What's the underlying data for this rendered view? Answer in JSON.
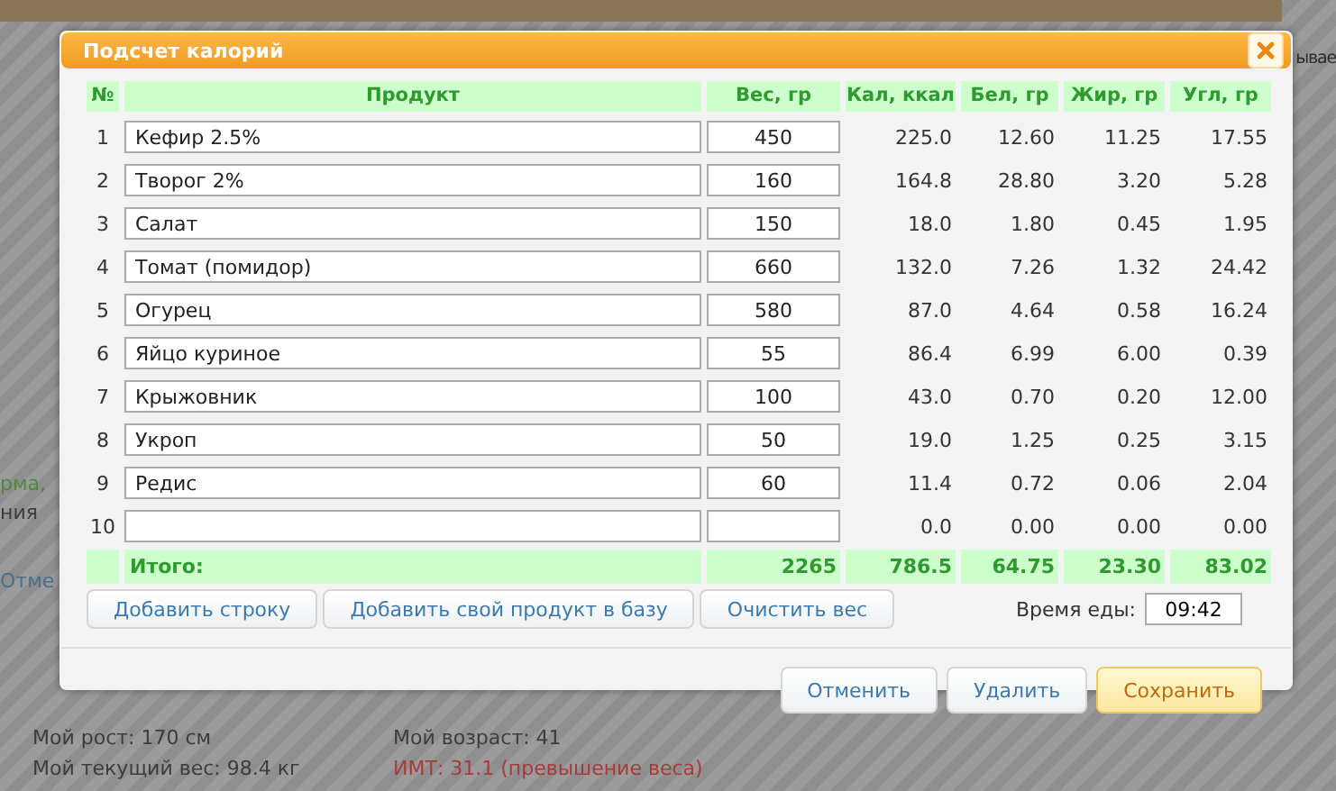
{
  "background_page": {
    "side_notes": [
      {
        "text": "рма,",
        "kind": "highlight"
      },
      {
        "text": "ния",
        "kind": "plain"
      },
      {
        "text": "Отме",
        "kind": "link"
      }
    ],
    "right_note": "ывае",
    "stats": [
      {
        "text": "Мой рост: 170 см",
        "kind": "plain"
      },
      {
        "text": "Мой возраст: 41",
        "kind": "plain"
      },
      {
        "text": "Мой текущий вес: 98.4 кг",
        "kind": "plain"
      },
      {
        "text": "ИМТ: 31.1 (превышение веса)",
        "kind": "warning"
      }
    ]
  },
  "dialog": {
    "title": "Подсчет калорий",
    "columns": [
      "№",
      "Продукт",
      "Вес, гр",
      "Кал, ккал",
      "Бел, гр",
      "Жир, гр",
      "Угл, гр"
    ],
    "rows": [
      {
        "number": "1",
        "product": "Кефир 2.5%",
        "weight": "450",
        "kcal": "225.0",
        "protein": "12.60",
        "fat": "11.25",
        "carbs": "17.55"
      },
      {
        "number": "2",
        "product": "Творог 2%",
        "weight": "160",
        "kcal": "164.8",
        "protein": "28.80",
        "fat": "3.20",
        "carbs": "5.28"
      },
      {
        "number": "3",
        "product": "Салат",
        "weight": "150",
        "kcal": "18.0",
        "protein": "1.80",
        "fat": "0.45",
        "carbs": "1.95"
      },
      {
        "number": "4",
        "product": "Томат (помидор)",
        "weight": "660",
        "kcal": "132.0",
        "protein": "7.26",
        "fat": "1.32",
        "carbs": "24.42"
      },
      {
        "number": "5",
        "product": "Огурец",
        "weight": "580",
        "kcal": "87.0",
        "protein": "4.64",
        "fat": "0.58",
        "carbs": "16.24"
      },
      {
        "number": "6",
        "product": "Яйцо куриное",
        "weight": "55",
        "kcal": "86.4",
        "protein": "6.99",
        "fat": "6.00",
        "carbs": "0.39"
      },
      {
        "number": "7",
        "product": "Крыжовник",
        "weight": "100",
        "kcal": "43.0",
        "protein": "0.70",
        "fat": "0.20",
        "carbs": "12.00"
      },
      {
        "number": "8",
        "product": "Укроп",
        "weight": "50",
        "kcal": "19.0",
        "protein": "1.25",
        "fat": "0.25",
        "carbs": "3.15"
      },
      {
        "number": "9",
        "product": "Редис",
        "weight": "60",
        "kcal": "11.4",
        "protein": "0.72",
        "fat": "0.06",
        "carbs": "2.04"
      },
      {
        "number": "10",
        "kcal": "0.0",
        "protein": "0.00",
        "fat": "0.00",
        "carbs": "0.00"
      }
    ],
    "totals": {
      "label": "Итого:",
      "weight": "2265",
      "kcal": "786.5",
      "protein": "64.75",
      "fat": "23.30",
      "carbs": "83.02"
    },
    "actions": [
      "Добавить строку",
      "Добавить свой продукт в базу",
      "Очистить вес"
    ],
    "meal_time": {
      "label": "Время еды:",
      "value": "09:42"
    },
    "buttons": [
      {
        "label": "Отменить",
        "kind": "normal"
      },
      {
        "label": "Удалить",
        "kind": "normal"
      },
      {
        "label": "Сохранить",
        "kind": "primary"
      }
    ]
  }
}
